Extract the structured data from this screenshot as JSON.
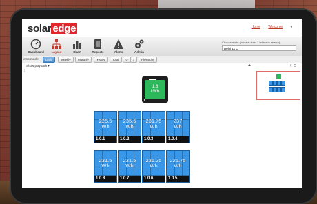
{
  "header": {
    "logo_text": "solar",
    "logo_accent": "edge",
    "links": [
      "Home",
      "Welcome"
    ]
  },
  "nav": {
    "items": [
      {
        "label": "Dashboard",
        "icon": "gauge-icon"
      },
      {
        "label": "Layout",
        "icon": "sitemap-icon"
      },
      {
        "label": "Chart",
        "icon": "bar-chart-icon"
      },
      {
        "label": "Reports",
        "icon": "report-icon"
      },
      {
        "label": "Alerts",
        "icon": "warning-icon"
      },
      {
        "label": "Admin",
        "icon": "gears-icon"
      }
    ],
    "active": "Layout",
    "site_search_label": "Choose a site (enter at least 3 letters to search):",
    "site_search_value": "Delhi 11 C"
  },
  "toolbar": {
    "label": "emp mode:",
    "buttons": [
      "Daily",
      "Weekly",
      "Monthly",
      "Yearly",
      "Total"
    ],
    "active": "Daily",
    "hierarchy_label": "Hierarchy"
  },
  "playback": {
    "label": "Show playback ▾"
  },
  "inverter": {
    "value": "1.8",
    "unit": "kWh",
    "id": "1"
  },
  "panels": [
    {
      "value": "225.5",
      "unit": "Wh",
      "id": "1.0.1"
    },
    {
      "value": "235.5",
      "unit": "Wh",
      "id": "1.0.2"
    },
    {
      "value": "231.75",
      "unit": "Wh",
      "id": "1.0.3"
    },
    {
      "value": "237",
      "unit": "Wh",
      "id": "1.0.4"
    },
    {
      "value": "231.5",
      "unit": "Wh",
      "id": "1.0.8"
    },
    {
      "value": "231.5",
      "unit": "Wh",
      "id": "1.0.7"
    },
    {
      "value": "236.25",
      "unit": "Wh",
      "id": "1.0.6"
    },
    {
      "value": "225.75",
      "unit": "Wh",
      "id": "1.0.5"
    }
  ],
  "colors": {
    "accent": "#e1262d",
    "panel": "#3a97e8",
    "inverter_screen": "#2eb85c"
  }
}
